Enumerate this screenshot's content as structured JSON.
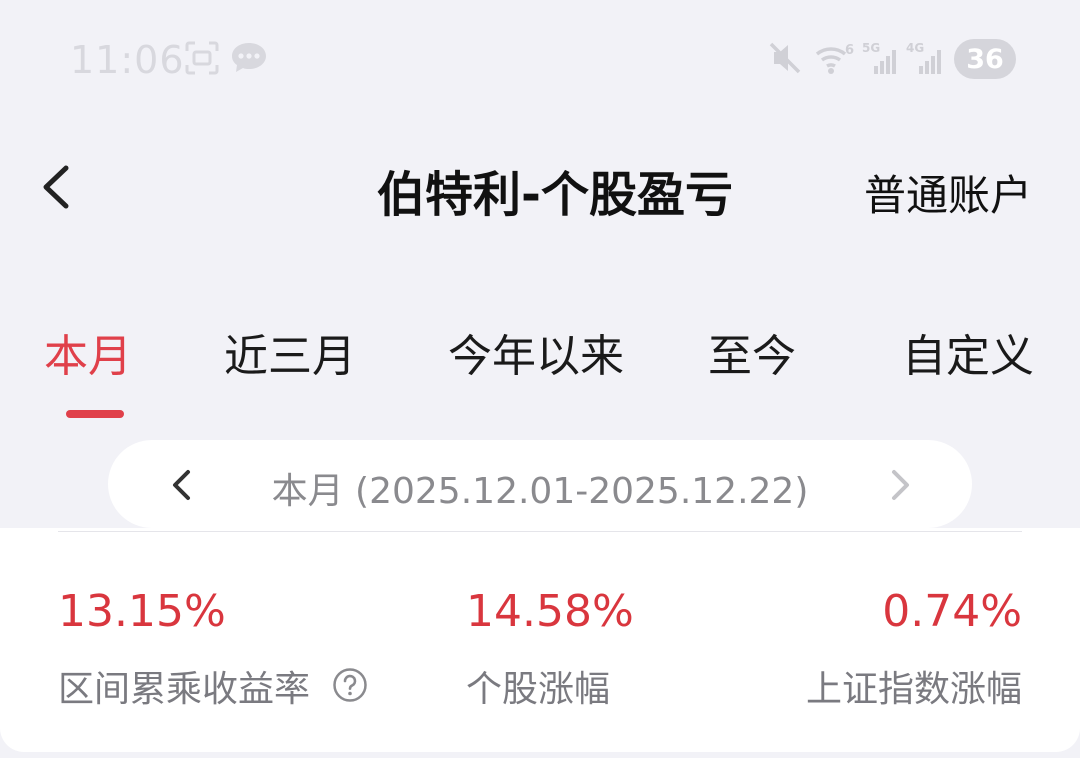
{
  "status_bar": {
    "time": "11:06",
    "battery": "36",
    "wifi_badge": "6",
    "sim1": "5G",
    "sim2": "4G"
  },
  "header": {
    "title": "伯特利-个股盈亏",
    "account_label": "普通账户"
  },
  "tabs": [
    {
      "label": "本月",
      "active": true
    },
    {
      "label": "近三月",
      "active": false
    },
    {
      "label": "今年以来",
      "active": false
    },
    {
      "label": "至今",
      "active": false
    },
    {
      "label": "自定义",
      "active": false
    }
  ],
  "date_selector": {
    "label": "本月 (2025.12.01-2025.12.22)"
  },
  "stats": [
    {
      "value": "13.15%",
      "label": "区间累乘收益率"
    },
    {
      "value": "14.58%",
      "label": "个股涨幅"
    },
    {
      "value": "0.74%",
      "label": "上证指数涨幅"
    }
  ],
  "colors": {
    "accent": "#e0404a",
    "positive": "#d9363e",
    "background": "#f2f2f7"
  }
}
